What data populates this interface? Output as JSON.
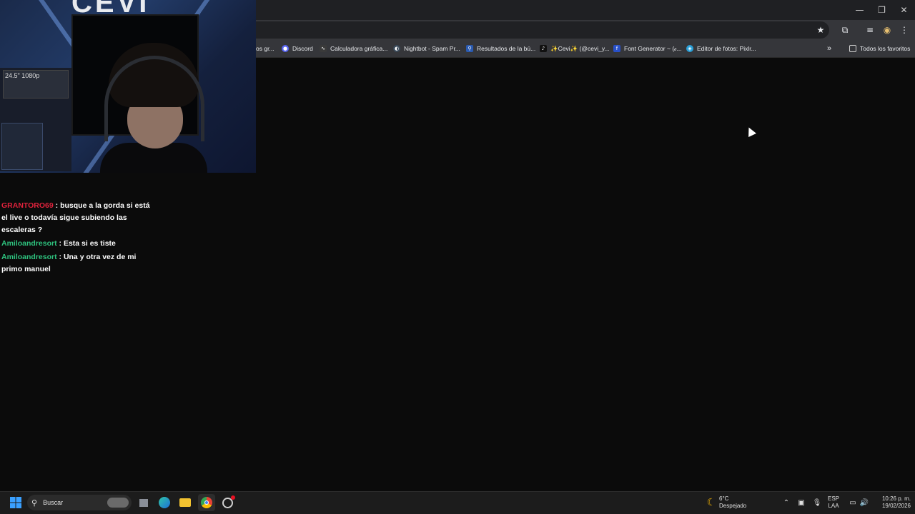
{
  "window": {
    "controls": [
      {
        "name": "minimize",
        "glyph": "—"
      },
      {
        "name": "restore",
        "glyph": "❐"
      },
      {
        "name": "close",
        "glyph": "✕"
      }
    ]
  },
  "toolbar_icons": [
    {
      "name": "bookmark-star-icon",
      "glyph": "★"
    },
    {
      "name": "extensions-icon",
      "glyph": "⧉"
    },
    {
      "name": "media-controls-icon",
      "glyph": "≡"
    },
    {
      "name": "profile-icon",
      "glyph": "◉"
    },
    {
      "name": "more-menu-icon",
      "glyph": "⋮"
    }
  ],
  "bookmarks": [
    {
      "label": "os gr...",
      "icon": "partial",
      "color": "#35363a"
    },
    {
      "label": "Discord",
      "icon": "discord-icon",
      "color": "#5865f2"
    },
    {
      "label": "Calculadora gráfica...",
      "icon": "desmos-icon",
      "color": "#3a3a3a"
    },
    {
      "label": "Nightbot - Spam Pr...",
      "icon": "nightbot-icon",
      "color": "#3a4a5a"
    },
    {
      "label": "Resultados de la bú...",
      "icon": "search-result-icon",
      "color": "#2a5ab0"
    },
    {
      "label": "✨Cevi✨ (@cevi_y...",
      "icon": "tiktok-icon",
      "color": "#111111"
    },
    {
      "label": "Font Generator ~ (𝒸...",
      "icon": "font-generator-icon",
      "color": "#2850c8"
    },
    {
      "label": "Editor de fotos: Pixlr...",
      "icon": "pixlr-icon",
      "color": "#2aa0d8"
    }
  ],
  "bookmarks_overflow": "»",
  "all_bookmarks_label": "Todos los favoritos",
  "webcam": {
    "logo_text": "CEVI",
    "box_label": "24.5\" 1080p"
  },
  "chat": {
    "messages": [
      {
        "user": "GRANTORO69",
        "user_color": "#e0223c",
        "text": " : busque a la gorda si está el live o todavía sigue subiendo las escaleras ?"
      },
      {
        "user": "Amiloandresort",
        "user_color": "#2ec27e",
        "text": " : Esta si es tiste"
      },
      {
        "user": "Amiloandresort",
        "user_color": "#2ec27e",
        "text": " : Una y otra vez de mi primo manuel"
      }
    ]
  },
  "taskbar": {
    "search_placeholder": "Buscar",
    "weather_temp": "6°C",
    "weather_desc": "Despejado",
    "language_top": "ESP",
    "language_bottom": "LAA",
    "time": "10:26 p. m.",
    "date": "19/02/2026"
  }
}
